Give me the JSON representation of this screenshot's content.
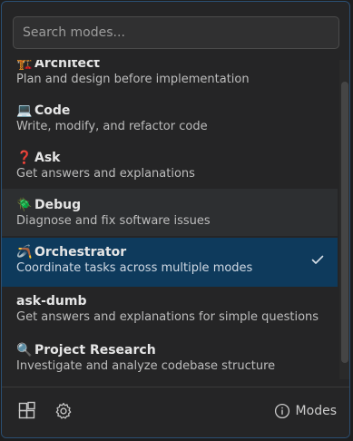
{
  "search": {
    "placeholder": "Search modes..."
  },
  "modes": [
    {
      "emoji": "🏗️",
      "name": "Architect",
      "description": "Plan and design before implementation",
      "state": "normal"
    },
    {
      "emoji": "💻",
      "name": "Code",
      "description": "Write, modify, and refactor code",
      "state": "normal"
    },
    {
      "emoji": "❓",
      "name": "Ask",
      "description": "Get answers and explanations",
      "state": "normal"
    },
    {
      "emoji": "🪲",
      "name": "Debug",
      "description": "Diagnose and fix software issues",
      "state": "hover"
    },
    {
      "emoji": "🪃",
      "name": "Orchestrator",
      "description": "Coordinate tasks across multiple modes",
      "state": "selected"
    },
    {
      "emoji": "",
      "name": "ask-dumb",
      "description": "Get answers and explanations for simple questions",
      "state": "normal"
    },
    {
      "emoji": "🔍",
      "name": "Project Research",
      "description": "Investigate and analyze codebase structure",
      "state": "normal"
    }
  ],
  "footer": {
    "modes_label": "Modes",
    "left_icons": [
      "marketplace-icon",
      "gear-icon"
    ],
    "info_icon": "info-icon"
  },
  "colors": {
    "accent_border": "#2b4f73",
    "selected_bg": "#0e3a5c",
    "hover_bg": "#2d2f31"
  }
}
